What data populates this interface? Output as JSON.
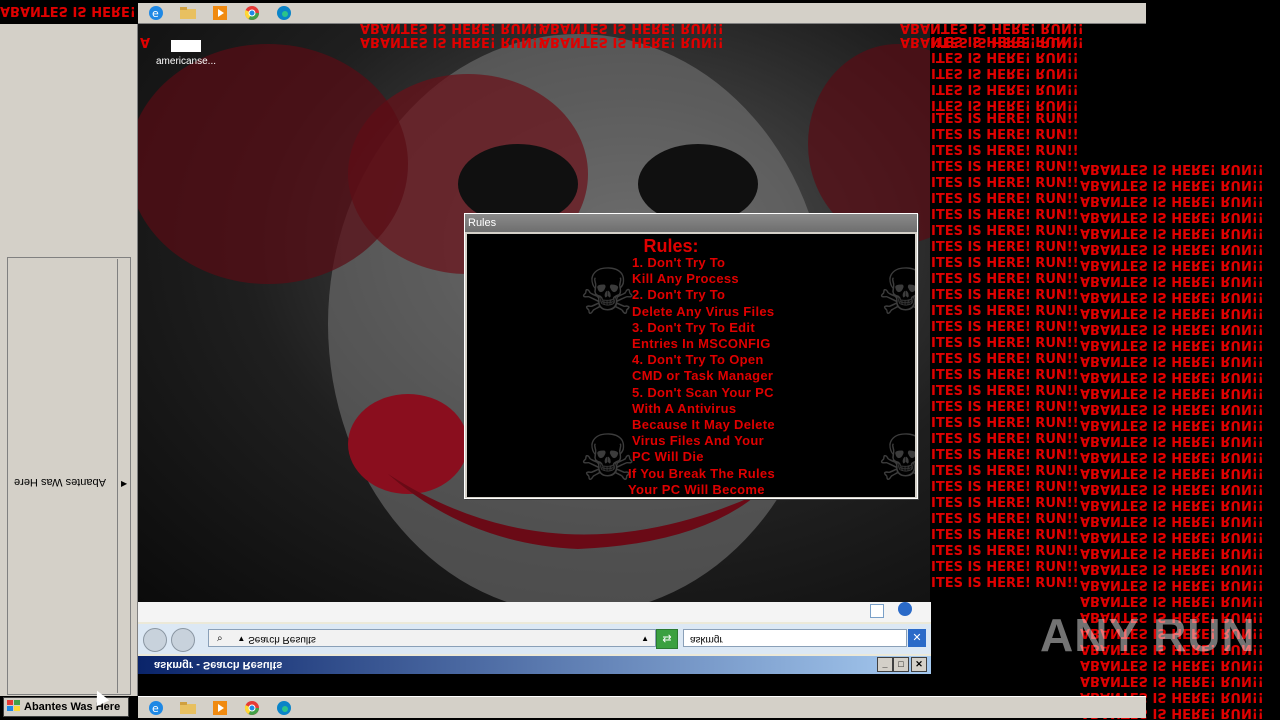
{
  "top_stripe_text": "ABANTES IS HERE! RUN!!",
  "right_column_a_text": "ITES IS HERE! RUN!!",
  "right_column_b_text": "ABANTES IS HERE! RUN!!",
  "desktop": {
    "icon_label": "americanse..."
  },
  "taskbar_icons": [
    "ie-icon",
    "explorer-icon",
    "media-player-icon",
    "chrome-icon",
    "edge-icon"
  ],
  "start_button": {
    "label": "Abantes Was Here"
  },
  "left_panel": {
    "vertical_label": "Abantes Was Here"
  },
  "rules_window": {
    "title": "Rules",
    "heading": "Rules:",
    "lines": [
      "1. Don't Try To",
      "Kill Any Process",
      "2. Don't Try To",
      "Delete Any Virus Files",
      "3. Don't Try To Edit",
      "Entries In MSCONFIG",
      "4. Don't Try To Open",
      "CMD or Task Manager",
      "5. Don't Scan Your PC",
      "With A Antivirus",
      "Because It May Delete",
      "Virus Files And Your",
      "PC Will Die",
      "If You Break The Rules",
      "Your PC Will Become"
    ]
  },
  "explorer_window": {
    "title": "askmgr - Search Results",
    "address": "Search Results",
    "search_value": "askmgr"
  },
  "watermark": "ANY RUN",
  "colors": {
    "stripe_red": "#e00000"
  }
}
